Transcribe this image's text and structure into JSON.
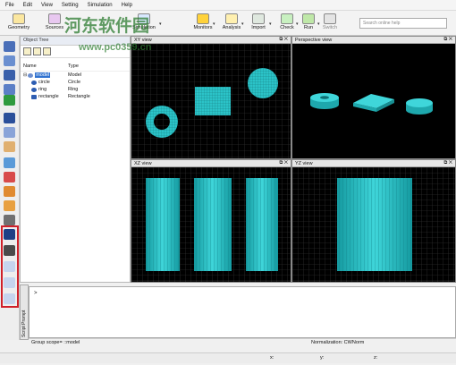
{
  "menu": [
    "File",
    "Edit",
    "View",
    "Setting",
    "Simulation",
    "Help"
  ],
  "toolbar": {
    "buttons": [
      "Geometry",
      "Sources",
      "Simulation",
      "Monitors",
      "Analysis",
      "Import",
      "Check",
      "Run",
      "Switch"
    ],
    "search_placeholder": "Search online help"
  },
  "tree": {
    "header": "Object Tree",
    "col_name": "Name",
    "col_type": "Type",
    "rows": [
      {
        "name": "model",
        "type": "Model"
      },
      {
        "name": "circle",
        "type": "Circle"
      },
      {
        "name": "ring",
        "type": "Ring"
      },
      {
        "name": "rectangle",
        "type": "Rectangle"
      }
    ]
  },
  "views": {
    "xy": "XY view",
    "perspective": "Perspective view",
    "xz": "XZ view",
    "yz": "YZ view"
  },
  "console": {
    "prompt": ">",
    "tab": "Script Prompt"
  },
  "status": {
    "group_scope": "Group scope= ::model",
    "normalization": "Normalization: CWNorm",
    "x": "x:",
    "y": "y:",
    "z": "z:"
  },
  "watermark": {
    "cn": "河东软件园",
    "url": "www.pc0359.cn"
  },
  "colors": {
    "accent_red": "#d0202a",
    "object_cyan": "#2bc3c8",
    "viewport_bg": "#000000"
  }
}
